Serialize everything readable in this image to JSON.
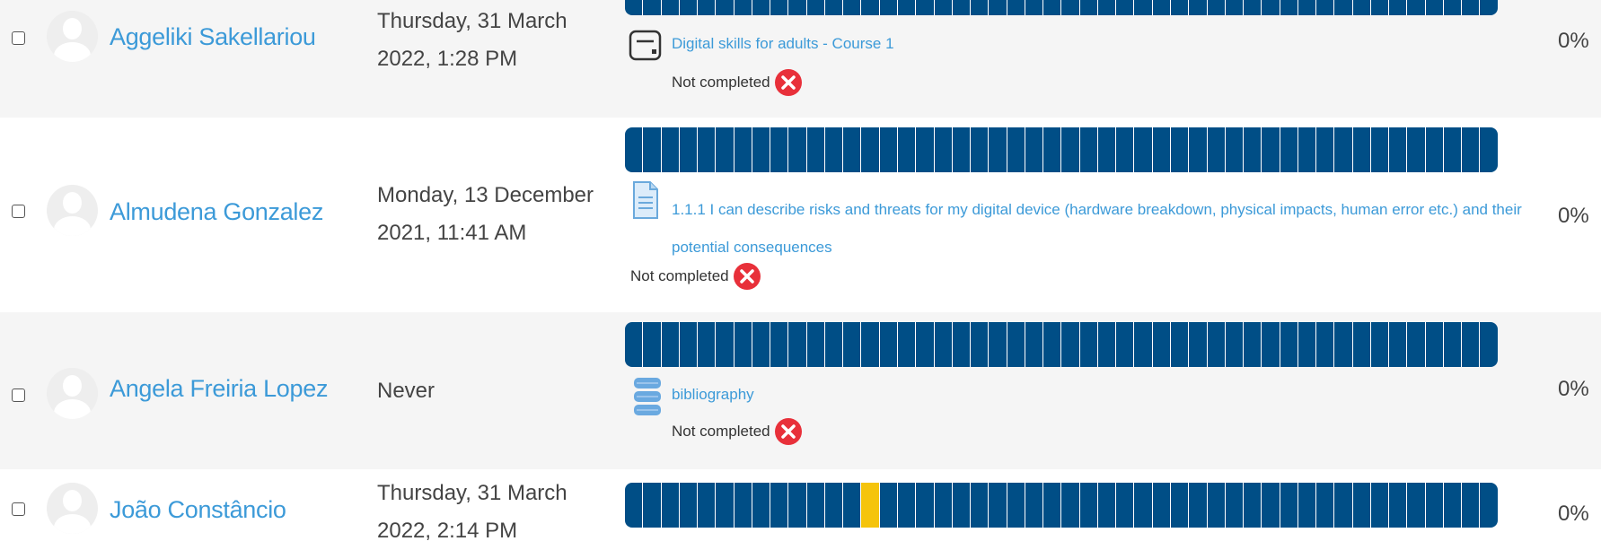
{
  "rows": [
    {
      "name": "Aggeliki Sakellariou",
      "last_access_line1": "Thursday, 31 March",
      "last_access_line2": "2022, 1:28 PM",
      "activity_title": "Digital skills for adults - Course 1",
      "activity_icon": "assignment-icon",
      "status": "Not completed",
      "percent": "0%"
    },
    {
      "name": "Almudena Gonzalez",
      "last_access_line1": "Monday, 13 December",
      "last_access_line2": "2021, 11:41 AM",
      "activity_title_line1": "1.1.1 I can describe risks and threats for my digital device (hardware breakdown, physical impacts, human error etc.) and their",
      "activity_title_line2": "potential consequences",
      "activity_icon": "document-icon",
      "status": "Not completed",
      "percent": "0%"
    },
    {
      "name": "Angela Freiria Lopez",
      "last_access": "Never",
      "activity_title": "bibliography",
      "activity_icon": "database-icon",
      "status": "Not completed",
      "percent": "0%"
    },
    {
      "name": "João Constâncio",
      "last_access_line1": "Thursday, 31 March",
      "last_access_line2": "2022, 2:14 PM",
      "percent": "0%"
    }
  ],
  "progress": {
    "total_activities": 48,
    "bar_color": "#004e86",
    "highlight_color": "#f5c40c",
    "highlight_activity_number": 14
  },
  "colors": {
    "link": "#3c9ad8",
    "not_completed": "#e8303a",
    "row_shade": "#f5f5f5"
  }
}
